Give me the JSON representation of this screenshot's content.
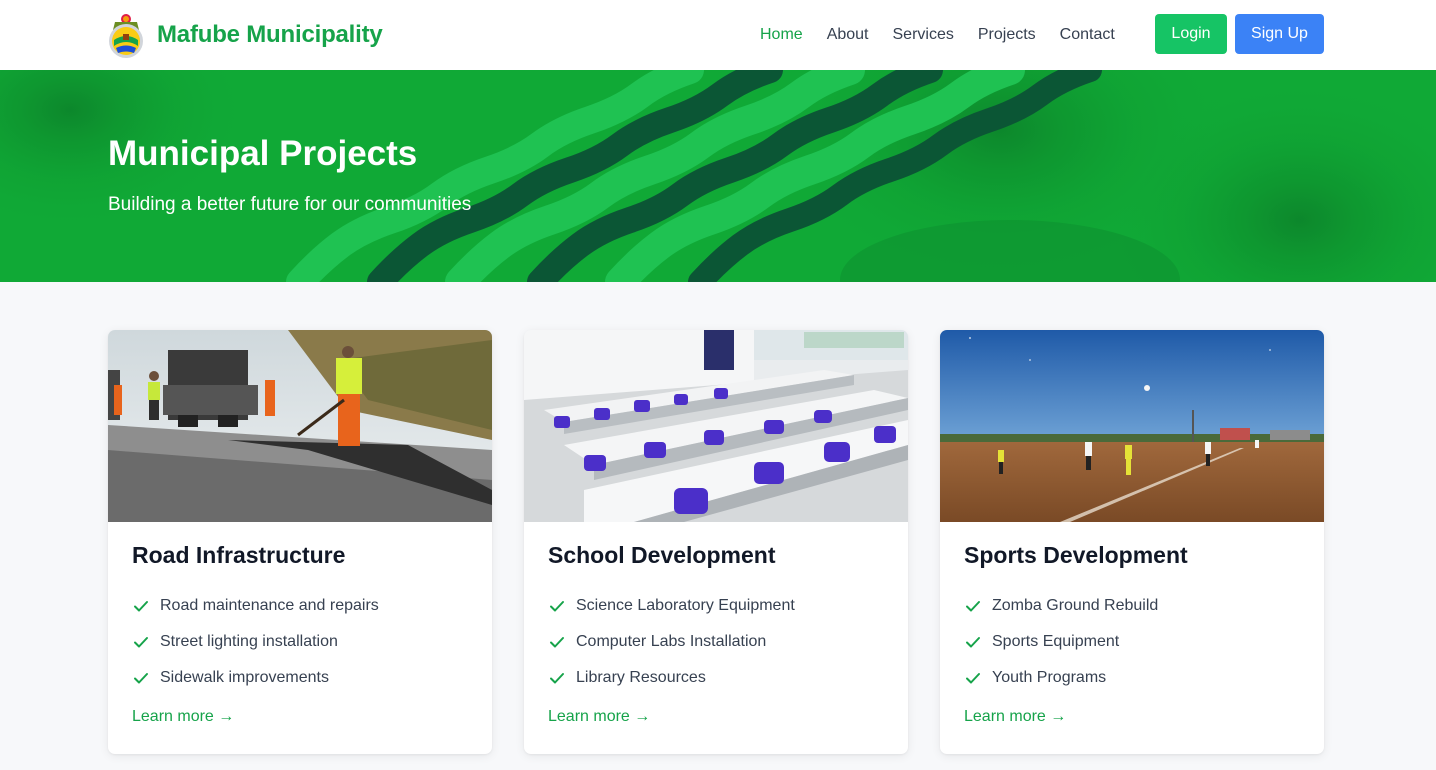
{
  "brand": {
    "name": "Mafube Municipality",
    "logo_icon": "municipal-crest-icon"
  },
  "nav": {
    "links": [
      {
        "label": "Home",
        "active": true
      },
      {
        "label": "About",
        "active": false
      },
      {
        "label": "Services",
        "active": false
      },
      {
        "label": "Projects",
        "active": false
      },
      {
        "label": "Contact",
        "active": false
      }
    ],
    "login_label": "Login",
    "signup_label": "Sign Up"
  },
  "hero": {
    "title": "Municipal Projects",
    "subtitle": "Building a better future for our communities"
  },
  "projects": [
    {
      "title": "Road Infrastructure",
      "image": "road-works-photo",
      "features": [
        "Road maintenance and repairs",
        "Street lighting installation",
        "Sidewalk improvements"
      ],
      "link_label": "Learn more →"
    },
    {
      "title": "School Development",
      "image": "science-lab-photo",
      "features": [
        "Science Laboratory Equipment",
        "Computer Labs Installation",
        "Library Resources"
      ],
      "link_label": "Learn more →"
    },
    {
      "title": "Sports Development",
      "image": "soccer-field-photo",
      "features": [
        "Zomba Ground Rebuild",
        "Sports Equipment",
        "Youth Programs"
      ],
      "link_label": "Learn more →"
    }
  ],
  "colors": {
    "brand_green": "#16a34a",
    "login_button": "#16c465",
    "signup_button": "#3b82f6",
    "hero_green": "#11b83b",
    "check_green": "#16a34a"
  }
}
